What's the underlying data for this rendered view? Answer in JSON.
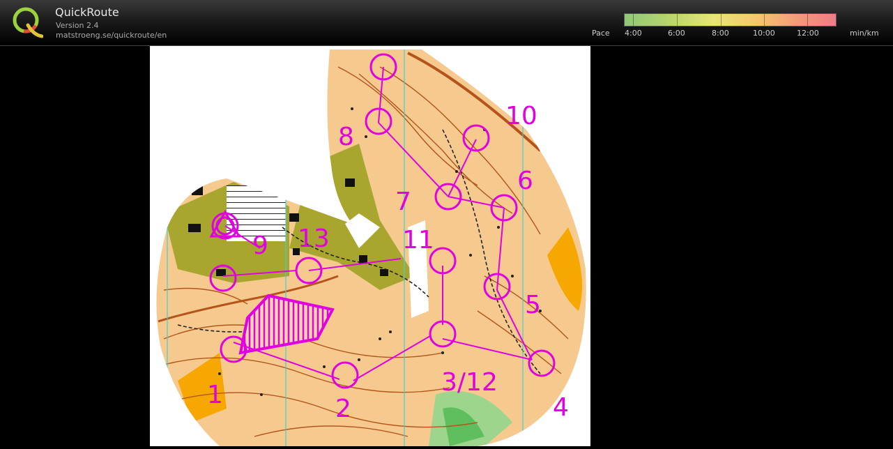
{
  "app": {
    "title": "QuickRoute",
    "version": "Version 2.4",
    "url": "matstroeng.se/quickroute/en"
  },
  "pace_legend": {
    "label": "Pace",
    "ticks": [
      "4:00",
      "6:00",
      "8:00",
      "10:00",
      "12:00"
    ],
    "unit": "min/km",
    "colors": [
      "#8fc877",
      "#e8e676",
      "#f5c870",
      "#ee7d86"
    ]
  },
  "map": {
    "course_color": "#e000e0",
    "control_labels": [
      "1",
      "2",
      "3/12",
      "4",
      "5",
      "6",
      "7",
      "8",
      "9",
      "10",
      "11",
      "13"
    ]
  }
}
